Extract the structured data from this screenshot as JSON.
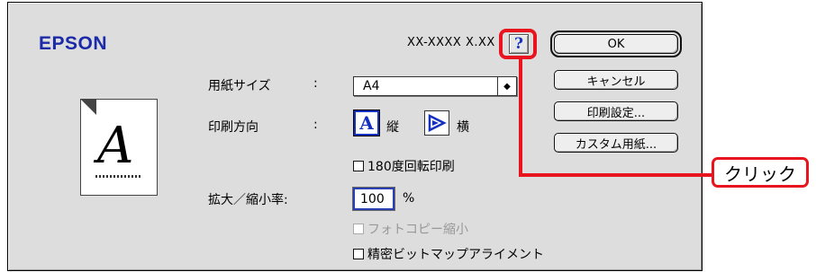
{
  "dialog": {
    "brand": "EPSON",
    "model": "XX-XXXX X.XX",
    "help_icon_glyph": "?",
    "buttons": {
      "ok": "OK",
      "cancel": "キャンセル",
      "print_settings": "印刷設定...",
      "custom_paper": "カスタム用紙..."
    },
    "preview": {
      "glyph": "A",
      "icon": "page-preview-icon"
    },
    "paper_size": {
      "label": "用紙サイズ",
      "colon": ":",
      "value": "A4",
      "arrow": "◆"
    },
    "orientation": {
      "label": "印刷方向",
      "colon": ":",
      "portrait_label": "縦",
      "landscape_label": "横",
      "portrait_glyph": "A",
      "selected": "portrait"
    },
    "rotate_180": {
      "label": "180度回転印刷",
      "checked": false
    },
    "scale": {
      "label": "拡大／縮小率:",
      "value": "100",
      "unit": "%"
    },
    "photocopy_reduce": {
      "label": "フォトコピー縮小",
      "checked": false,
      "enabled": false
    },
    "precise_bitmap": {
      "label": "精密ビットマップアライメント",
      "checked": false
    }
  },
  "callout": {
    "label": "クリック",
    "color": "#e8141e"
  },
  "colors": {
    "brand": "#1b2aa8",
    "accent": "#1530c0",
    "highlight": "#e8141e"
  }
}
